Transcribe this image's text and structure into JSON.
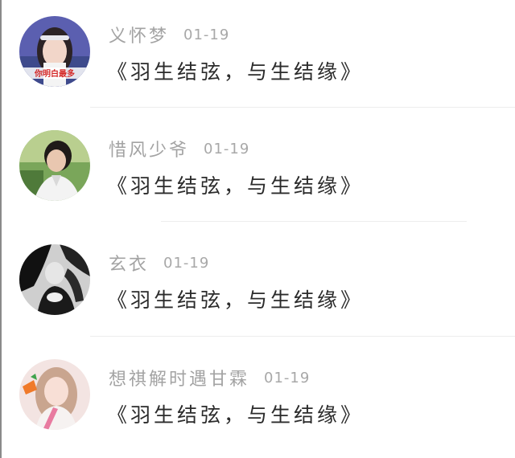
{
  "comments": [
    {
      "username": "义怀梦",
      "date": "01-19",
      "content": "《羽生结弦，与生结缘》",
      "avatar_icon": "avatar-girl-headband",
      "avatar_caption": "你明白最多"
    },
    {
      "username": "惜风少爷",
      "date": "01-19",
      "content": "《羽生结弦，与生结缘》",
      "avatar_icon": "avatar-man-outdoors"
    },
    {
      "username": "玄衣",
      "date": "01-19",
      "content": "《羽生结弦，与生结缘》",
      "avatar_icon": "avatar-bw-portrait"
    },
    {
      "username": "想祺解时遇甘霖",
      "date": "01-19",
      "content": "《羽生结弦，与生结缘》",
      "avatar_icon": "avatar-girl-carrot"
    }
  ]
}
